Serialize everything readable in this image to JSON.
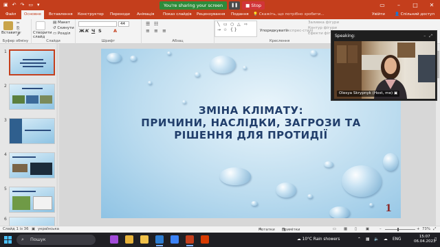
{
  "titlebar": {
    "save_icon": "save-icon",
    "undo_icon": "undo-icon",
    "redo_icon": "redo-icon",
    "present_icon": "present-icon",
    "sharing_text": "You're sharing your screen",
    "pause_icon": "pause-icon",
    "stop_label": "Stop",
    "color": "#c43e1c",
    "share_color": "#2e8b3a"
  },
  "tabs": [
    {
      "label": "Файл"
    },
    {
      "label": "Основне"
    },
    {
      "label": "Вставлення"
    },
    {
      "label": "Конструктор"
    },
    {
      "label": "Переходи"
    },
    {
      "label": "Анімація"
    },
    {
      "label": "Показ слайдів"
    },
    {
      "label": "Рецензування"
    },
    {
      "label": "Подання"
    }
  ],
  "tell_me": "Скажіть, що потрібно зробити...",
  "account": {
    "sign_in": "Увійти",
    "share": "Спільний доступ"
  },
  "ribbon": {
    "paste": "Вставити",
    "cut": "Макет",
    "copy": "Скинути",
    "format": "Розділ",
    "new_slide": "Створити слайд",
    "groups": {
      "clipboard": "Буфер обміну",
      "slides": "Слайди",
      "font": "Шрифт",
      "paragraph": "Абзац",
      "drawing": "Креслення"
    },
    "arrange": "Упорядкувати",
    "quick_styles": "Експрес-стилі",
    "shape_fill": "Заливка фігури",
    "shape_outline": "Контур фігури",
    "shape_effects": "Ефекти фігури",
    "font_size": "44"
  },
  "thumbnails": [
    {
      "num": "1"
    },
    {
      "num": "2"
    },
    {
      "num": "3"
    },
    {
      "num": "4"
    },
    {
      "num": "5"
    },
    {
      "num": "6"
    }
  ],
  "slide": {
    "title_line1": "ЗМІНА КЛІМАТУ:",
    "title_line2": "ПРИЧИНИ, НАСЛІДКИ, ЗАГРОЗИ ТА",
    "title_line3": "РІШЕННЯ ДЛЯ ПРОТИДІЇ",
    "number": "1",
    "title_color": "#213e6b"
  },
  "video": {
    "speaking_label": "Speaking:",
    "participant": "Olesya Skrypnyk (Host, me)"
  },
  "statusbar": {
    "slide_info": "Слайд 1 із 36",
    "language": "українська",
    "notes": "Нотатки",
    "comments": "Примітки",
    "zoom": "73%"
  },
  "taskbar": {
    "search_label": "Пошук",
    "weather": "10°C  Rain showers",
    "lang": "ENG",
    "time": "15:07",
    "date": "06.04.2023"
  }
}
